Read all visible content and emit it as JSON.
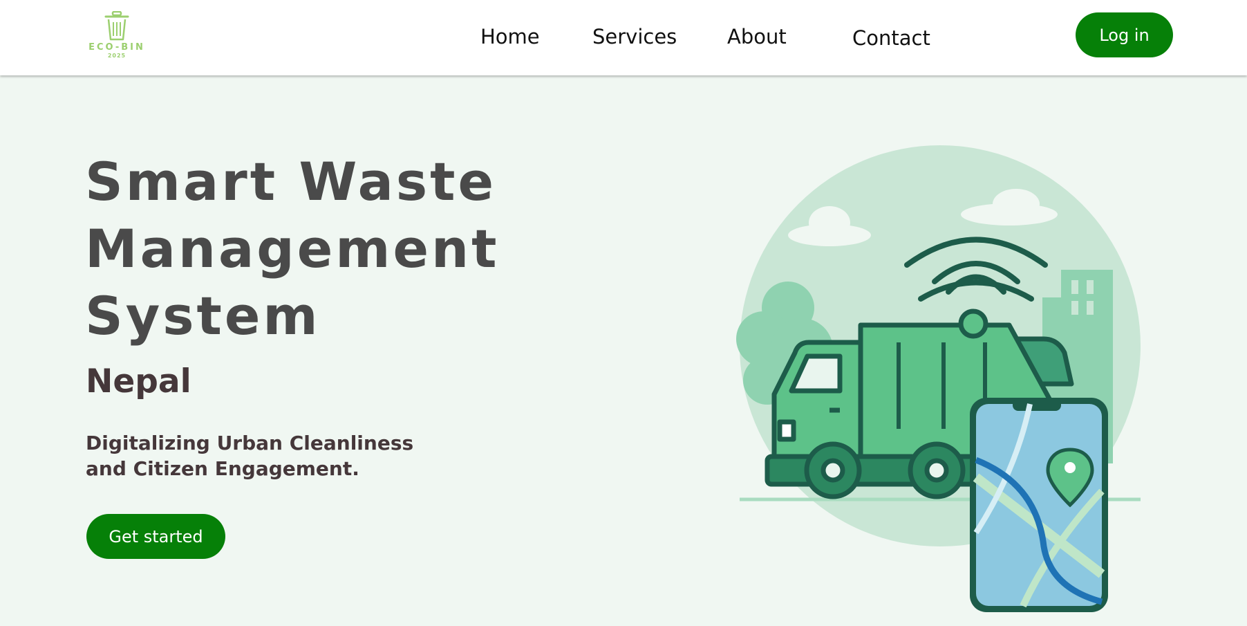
{
  "nav": {
    "logo_text": "ECO-BIN",
    "logo_year": "2025",
    "links": [
      "Home",
      "Services",
      "About",
      "Contact"
    ],
    "login_label": "Log in"
  },
  "hero": {
    "title_lines": [
      "Smart Waste",
      "Management",
      "System"
    ],
    "subtitle": "Nepal",
    "tagline_lines": [
      "Digitalizing Urban Cleanliness",
      "and Citizen Engagement."
    ],
    "cta_label": "Get started"
  },
  "colors": {
    "brand_green": "#068008",
    "logo_green": "#9ccf6f",
    "background": "#f0f7f2",
    "heading": "#4a4a4a",
    "text": "#45373a"
  },
  "illustration": {
    "icons": [
      "garbage-truck-icon",
      "smartphone-map-icon",
      "wifi-signal-icon",
      "location-pin-icon",
      "city-buildings-icon",
      "tree-icon",
      "cloud-icon"
    ]
  }
}
